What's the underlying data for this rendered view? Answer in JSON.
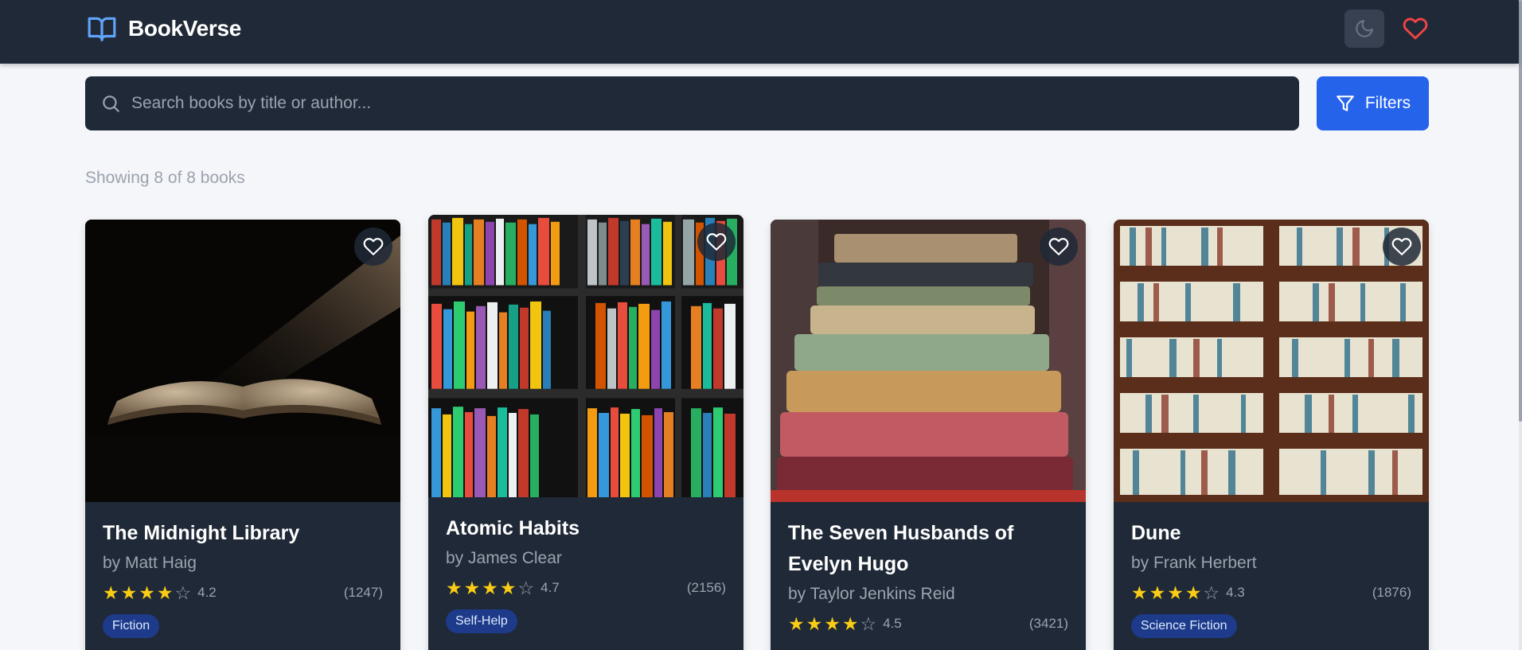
{
  "app": {
    "name": "BookVerse",
    "brand_color": "#60a5fa",
    "accent_color": "#2563eb",
    "heart_color": "#ef4444"
  },
  "header": {
    "logo_icon": "open-book-icon",
    "theme_toggle_icon": "moon-icon",
    "favorites_icon": "heart-icon"
  },
  "search": {
    "placeholder": "Search books by title or author...",
    "value": "",
    "icon": "search-icon"
  },
  "filters": {
    "label": "Filters",
    "icon": "funnel-icon"
  },
  "results_text": "Showing 8 of 8 books",
  "books": [
    {
      "title": "The Midnight Library",
      "author": "by Matt Haig",
      "rating": "4.2",
      "rating_value": 4.2,
      "reviews": "(1247)",
      "genre": "Fiction",
      "cover": "open-book-spotlight-image"
    },
    {
      "title": "Atomic Habits",
      "author": "by James Clear",
      "rating": "4.7",
      "rating_value": 4.7,
      "reviews": "(2156)",
      "genre": "Self-Help",
      "cover": "colorful-bookshelf-image"
    },
    {
      "title": "The Seven Husbands of Evelyn Hugo",
      "author": "by Taylor Jenkins Reid",
      "rating": "4.5",
      "rating_value": 4.5,
      "reviews": "(3421)",
      "genre": "",
      "cover": "stacked-old-books-image"
    },
    {
      "title": "Dune",
      "author": "by Frank Herbert",
      "rating": "4.3",
      "rating_value": 4.3,
      "reviews": "(1876)",
      "genre": "Science Fiction",
      "cover": "wooden-library-shelves-image"
    }
  ]
}
